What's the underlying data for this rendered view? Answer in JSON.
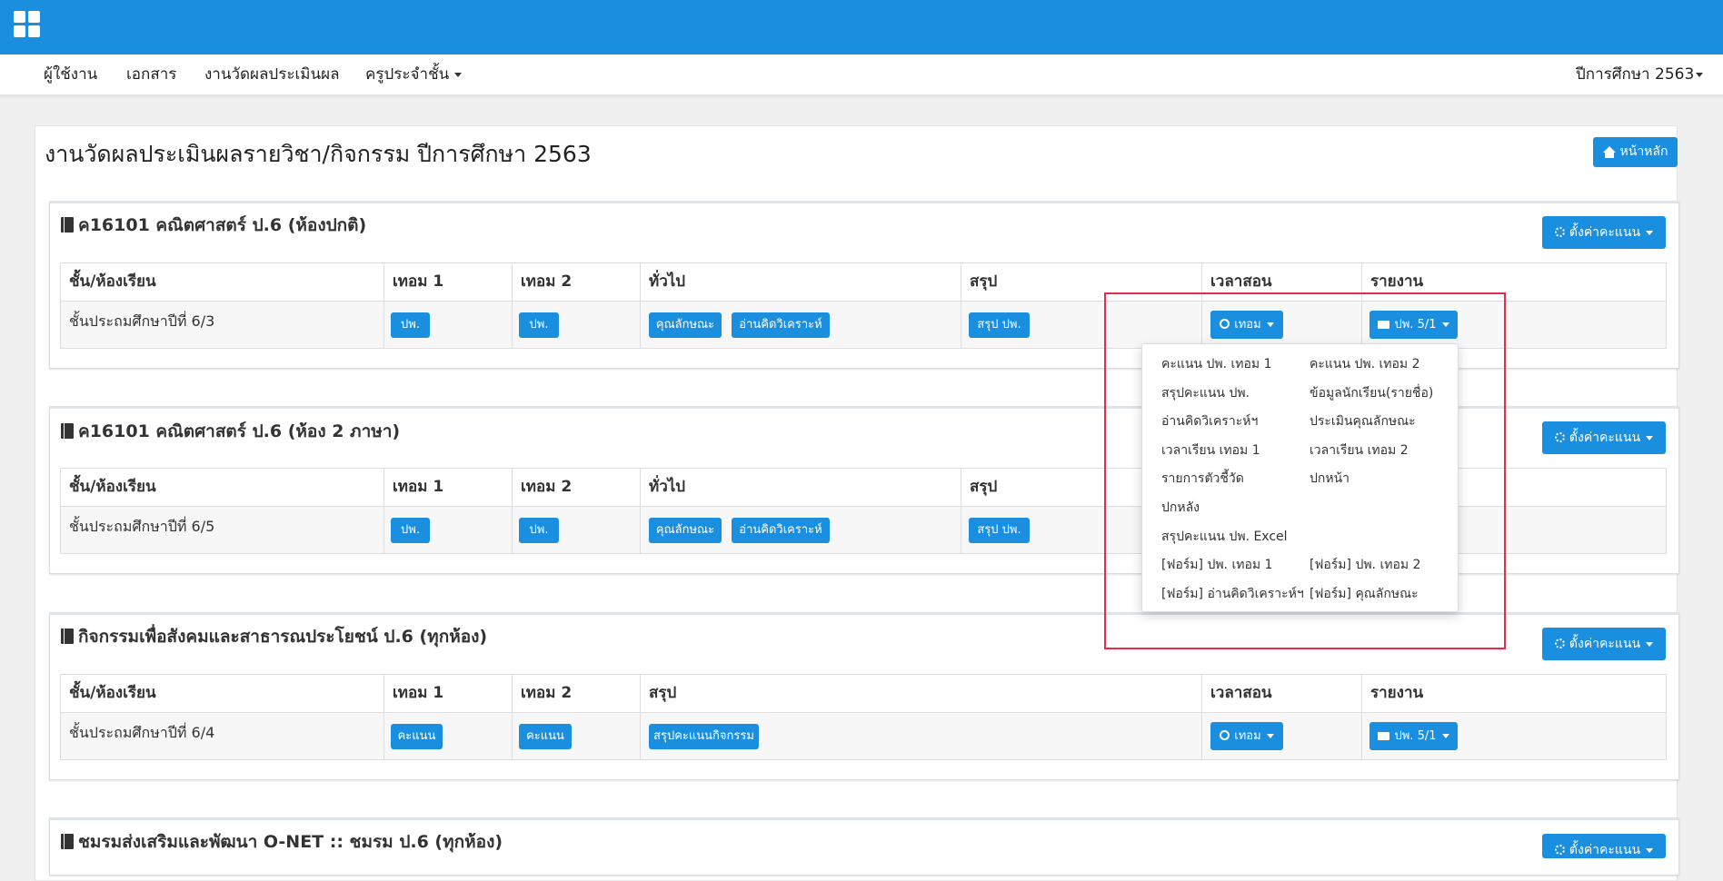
{
  "nav": {
    "items": [
      "ผู้ใช้งาน",
      "เอกสาร",
      "งานวัดผลประเมินผล",
      "ครูประจำชั้น"
    ],
    "year_selector": "ปีการศึกษา 2563"
  },
  "page": {
    "title": "งานวัดผลประเมินผลรายวิชา/กิจกรรม ปีการศึกษา 2563",
    "home_button": "หน้าหลัก"
  },
  "common": {
    "settings_button": "ตั้งค่าคะแนน",
    "time_button": "เทอม",
    "report_button": "ปพ. 5/1"
  },
  "panels": [
    {
      "title": "ค16101 คณิตศาสตร์ ป.6 (ห้องปกติ)",
      "headers": [
        "ชั้น/ห้องเรียน",
        "เทอม 1",
        "เทอม 2",
        "ทั่วไป",
        "สรุป",
        "เวลาสอน",
        "รายงาน"
      ],
      "row": {
        "label": "ชั้นประถมศึกษาปีที่ 6/3",
        "term1": "ปพ.",
        "term2": "ปพ.",
        "general": [
          "คุณลักษณะ",
          "อ่านคิดวิเคราะห์"
        ],
        "summary": "สรุป ปพ."
      }
    },
    {
      "title": "ค16101 คณิตศาสตร์ ป.6 (ห้อง 2 ภาษา)",
      "headers": [
        "ชั้น/ห้องเรียน",
        "เทอม 1",
        "เทอม 2",
        "ทั่วไป",
        "สรุป"
      ],
      "row": {
        "label": "ชั้นประถมศึกษาปีที่ 6/5",
        "term1": "ปพ.",
        "term2": "ปพ.",
        "general": [
          "คุณลักษณะ",
          "อ่านคิดวิเคราะห์"
        ],
        "summary": "สรุป ปพ."
      }
    },
    {
      "title": "กิจกรรมเพื่อสังคมและสาธารณประโยชน์ ป.6 (ทุกห้อง)",
      "headers": [
        "ชั้น/ห้องเรียน",
        "เทอม 1",
        "เทอม 2",
        "สรุป",
        "เวลาสอน",
        "รายงาน"
      ],
      "row": {
        "label": "ชั้นประถมศึกษาปีที่ 6/4",
        "term1": "คะแนน",
        "term2": "คะแนน",
        "summary": "สรุปคะแนนกิจกรรม"
      }
    },
    {
      "title": "ชมรมส่งเสริมและพัฒนา O-NET :: ชมรม ป.6 (ทุกห้อง)"
    }
  ],
  "report_menu": {
    "items": [
      "คะแนน ปพ. เทอม 1",
      "คะแนน ปพ. เทอม 2",
      "สรุปคะแนน ปพ.",
      "ข้อมูลนักเรียน(รายชื่อ)",
      "อ่านคิดวิเคราะห์ฯ",
      "ประเมินคุณลักษณะ",
      "เวลาเรียน เทอม 1",
      "เวลาเรียน เทอม 2",
      "รายการตัวชี้วัด",
      "ปกหน้า",
      "ปกหลัง",
      "สรุปคะแนน ปพ. Excel",
      "[ฟอร์ม] ปพ. เทอม 1",
      "[ฟอร์ม] ปพ. เทอม 2",
      "[ฟอร์ม] อ่านคิดวิเคราะห์ฯ",
      "[ฟอร์ม] คุณลักษณะ"
    ]
  },
  "colors": {
    "primary": "#1a8fe0",
    "highlight": "#e8294a"
  }
}
